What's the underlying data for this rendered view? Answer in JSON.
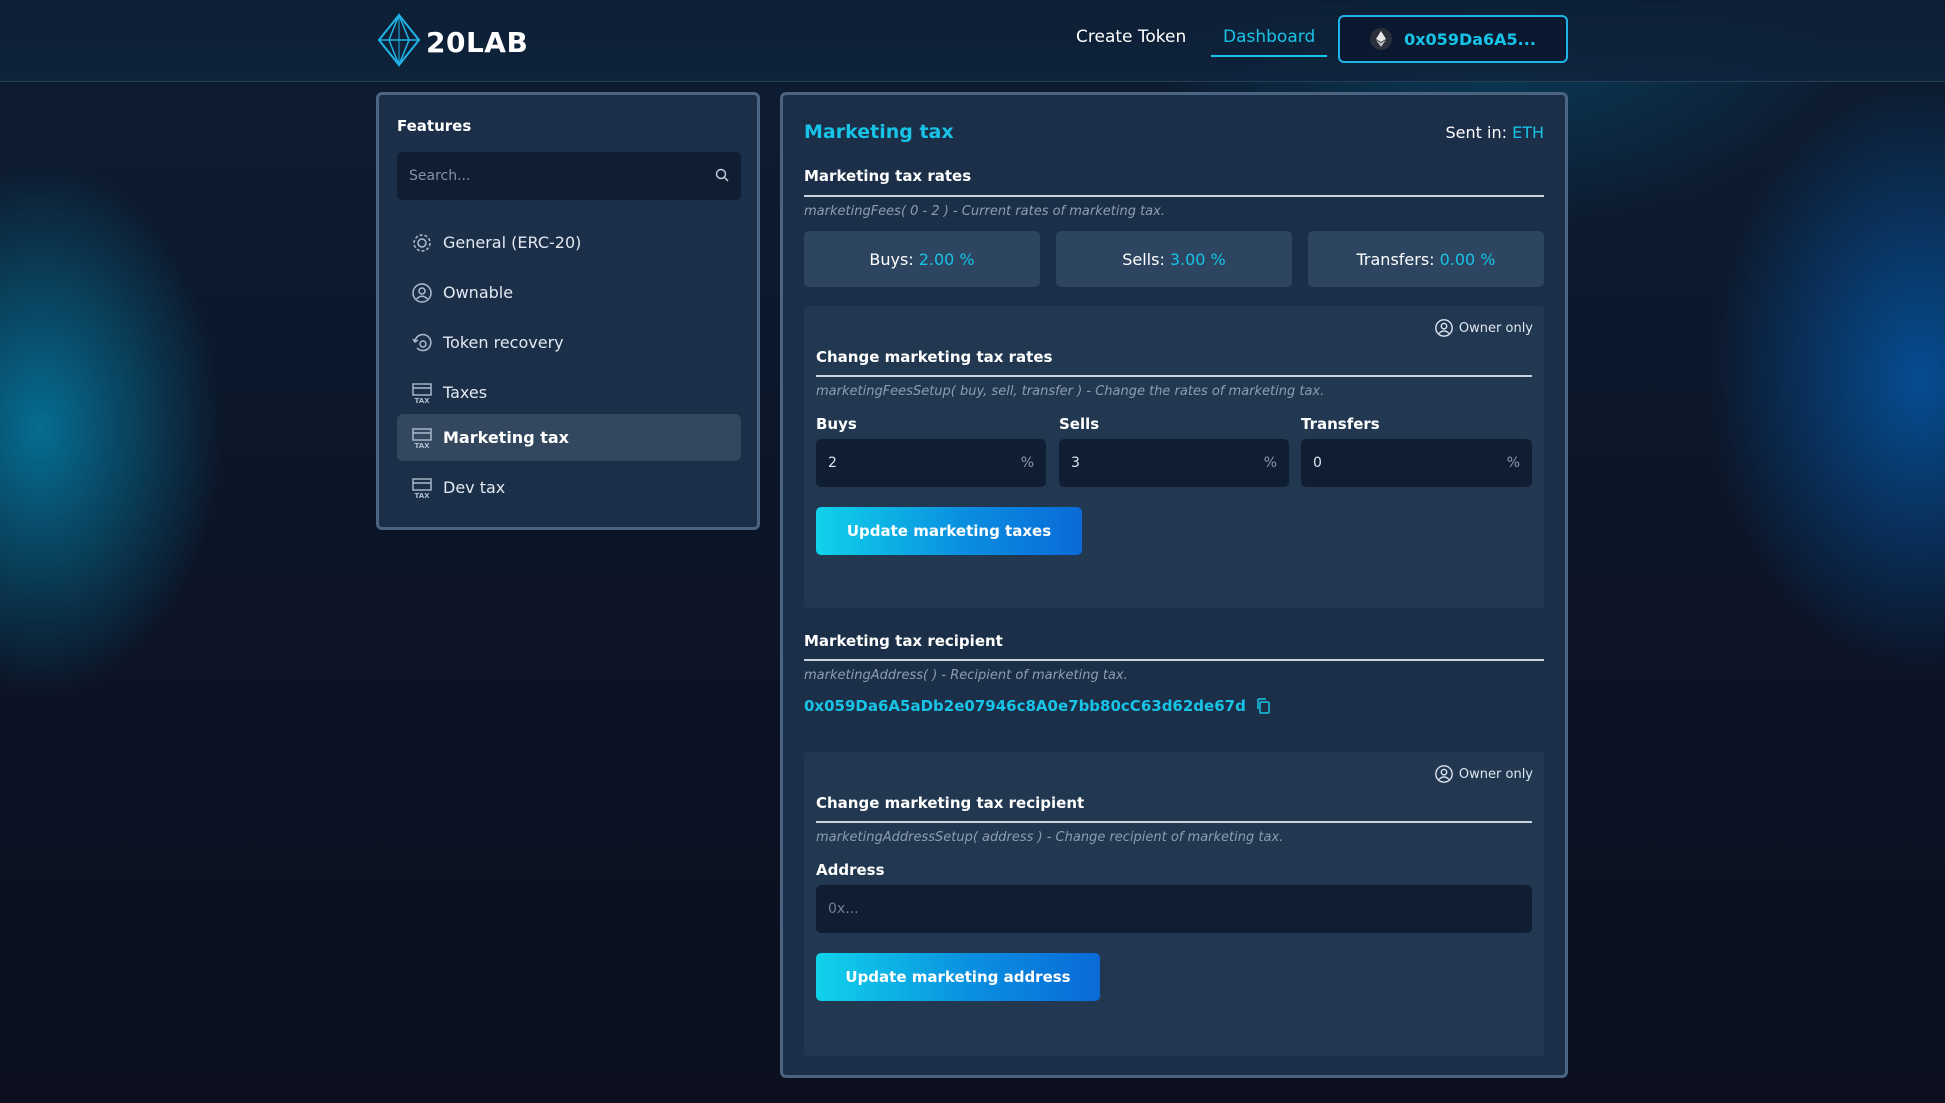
{
  "header": {
    "logo_text": "20LAB",
    "nav": {
      "create_token": "Create Token",
      "dashboard": "Dashboard"
    },
    "wallet_address": "0x059Da6A5..."
  },
  "sidebar": {
    "title": "Features",
    "search_placeholder": "Search...",
    "items": [
      {
        "label": "General (ERC-20)",
        "icon": "gear-icon"
      },
      {
        "label": "Ownable",
        "icon": "user-circle-icon"
      },
      {
        "label": "Token recovery",
        "icon": "recovery-icon"
      },
      {
        "label": "Taxes",
        "icon": "tax-icon"
      },
      {
        "label": "Marketing tax",
        "icon": "tax-icon",
        "active": true
      },
      {
        "label": "Dev tax",
        "icon": "tax-icon"
      }
    ]
  },
  "main": {
    "title": "Marketing tax",
    "sent_in_label": "Sent in:",
    "sent_in_value": "ETH",
    "rates": {
      "title": "Marketing tax rates",
      "description": "marketingFees( 0 - 2 ) - Current rates of marketing tax.",
      "buys_label": "Buys:",
      "buys_value": "2.00 %",
      "sells_label": "Sells:",
      "sells_value": "3.00 %",
      "transfers_label": "Transfers:",
      "transfers_value": "0.00 %"
    },
    "change_rates": {
      "owner_label": "Owner only",
      "title": "Change marketing tax rates",
      "description": "marketingFeesSetup( buy, sell, transfer ) - Change the rates of marketing tax.",
      "buys_label": "Buys",
      "buys_value": "2",
      "sells_label": "Sells",
      "sells_value": "3",
      "transfers_label": "Transfers",
      "transfers_value": "0",
      "unit": "%",
      "button_label": "Update marketing taxes"
    },
    "recipient": {
      "title": "Marketing tax recipient",
      "description": "marketingAddress( ) - Recipient of marketing tax.",
      "address": "0x059Da6A5aDb2e07946c8A0e7bb80cC63d62de67d"
    },
    "change_recipient": {
      "owner_label": "Owner only",
      "title": "Change marketing tax recipient",
      "description": "marketingAddressSetup( address ) - Change recipient of marketing tax.",
      "address_label": "Address",
      "address_placeholder": "0x...",
      "button_label": "Update marketing address"
    }
  },
  "colors": {
    "accent": "#17c3e6",
    "panel": "#1c2f48",
    "border": "#4a6482"
  }
}
